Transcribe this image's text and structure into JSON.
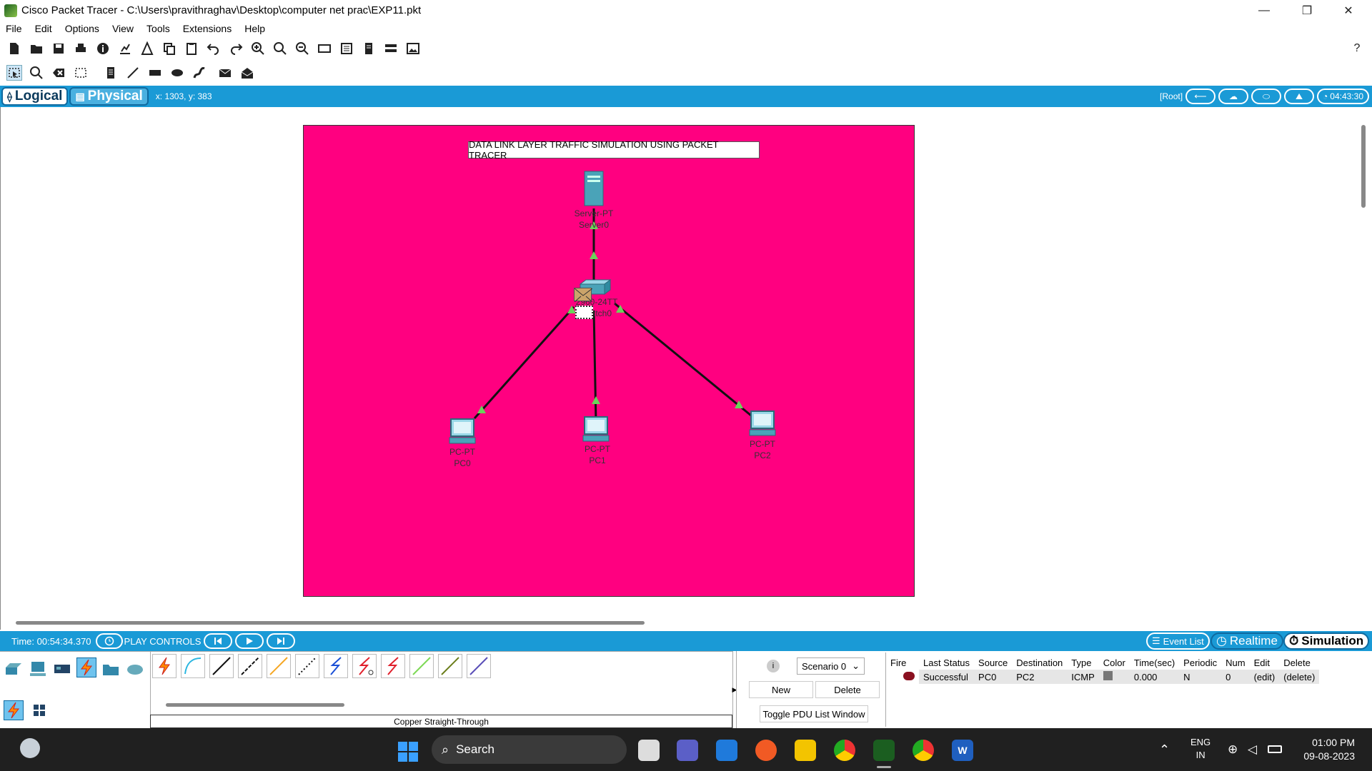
{
  "window": {
    "title": "Cisco Packet Tracer - C:\\Users\\pravithraghav\\Desktop\\computer net prac\\EXP11.pkt",
    "minimize": "—",
    "restore": "❐",
    "close": "✕"
  },
  "menu": [
    "File",
    "Edit",
    "Options",
    "View",
    "Tools",
    "Extensions",
    "Help"
  ],
  "help_icon": "?",
  "tabs": {
    "logical": "Logical",
    "physical": "Physical"
  },
  "coords": "x: 1303, y: 383",
  "root_label": "[Root]",
  "clock": "04:43:30",
  "canvas": {
    "note": "DATA LINK LAYER TRAFFIC SIMULATION USING PACKET TRACER",
    "devices": [
      {
        "id": "server0",
        "model": "Server-PT",
        "name": "Server0"
      },
      {
        "id": "switch0",
        "model": "2960-24TT",
        "name": "Switch0"
      },
      {
        "id": "pc0",
        "model": "PC-PT",
        "name": "PC0"
      },
      {
        "id": "pc1",
        "model": "PC-PT",
        "name": "PC1"
      },
      {
        "id": "pc2",
        "model": "PC-PT",
        "name": "PC2"
      }
    ]
  },
  "simbar": {
    "time": "Time: 00:54:34.370",
    "play_controls": "PLAY CONTROLS",
    "event_list": "Event List",
    "realtime": "Realtime",
    "simulation": "Simulation"
  },
  "cable_selected": "Copper Straight-Through",
  "scenario": {
    "selected": "Scenario 0",
    "new": "New",
    "delete": "Delete",
    "toggle": "Toggle PDU List Window",
    "headers": [
      "Fire",
      "Last Status",
      "Source",
      "Destination",
      "Type",
      "Color",
      "Time(sec)",
      "Periodic",
      "Num",
      "Edit",
      "Delete"
    ],
    "rows": [
      {
        "status": "Successful",
        "source": "PC0",
        "destination": "PC2",
        "type": "ICMP",
        "time": "0.000",
        "periodic": "N",
        "num": "0",
        "edit": "(edit)",
        "delete": "(delete)"
      }
    ]
  },
  "taskbar": {
    "search": "Search",
    "lang1": "ENG",
    "lang2": "IN",
    "time": "01:00 PM",
    "date": "09-08-2023"
  }
}
